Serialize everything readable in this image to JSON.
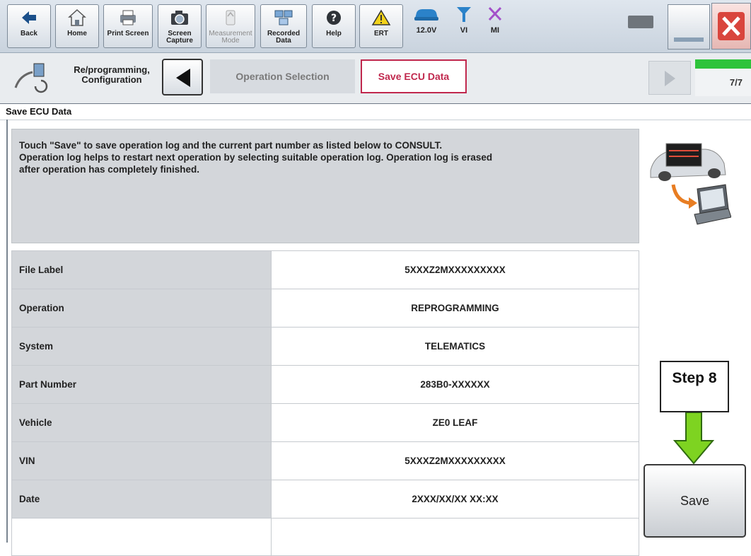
{
  "toolbar": {
    "buttons": [
      {
        "label": "Back",
        "icon": "back-arrow-icon"
      },
      {
        "label": "Home",
        "icon": "home-icon"
      },
      {
        "label": "Print Screen",
        "icon": "printer-icon"
      },
      {
        "label": "Screen Capture",
        "icon": "camera-icon"
      },
      {
        "label": "Measurement Mode",
        "icon": "measurement-icon"
      },
      {
        "label": "Recorded Data",
        "icon": "recorded-data-icon"
      },
      {
        "label": "Help",
        "icon": "help-icon"
      },
      {
        "label": "ERT",
        "icon": "warning-icon"
      }
    ],
    "voltage": "12.0V",
    "vi_label": "VI",
    "mi_label": "MI"
  },
  "breadcrumb": {
    "section": "Re/programming, Configuration",
    "steps": [
      "Operation Selection",
      "Save ECU Data"
    ],
    "progress_label": "7/7",
    "progress_fraction": 1.0
  },
  "page": {
    "title": "Save ECU Data",
    "message_lines": [
      "Touch \"Save\" to save operation log and the current part number as listed below to CONSULT.",
      "Operation log helps to restart next operation by selecting suitable operation log. Operation log is erased",
      "after operation has completely finished."
    ]
  },
  "table": {
    "rows": [
      {
        "label": "File Label",
        "value": "5XXXZ2MXXXXXXXXX"
      },
      {
        "label": "Operation",
        "value": "REPROGRAMMING"
      },
      {
        "label": "System",
        "value": "TELEMATICS"
      },
      {
        "label": "Part Number",
        "value": "283B0-XXXXXX"
      },
      {
        "label": "Vehicle",
        "value": "ZE0 LEAF"
      },
      {
        "label": "VIN",
        "value": "5XXXZ2MXXXXXXXXX"
      },
      {
        "label": "Date",
        "value": "2XXX/XX/XX XX:XX"
      }
    ]
  },
  "annotation": {
    "step_label": "Step 8",
    "arrow_color": "#7ed321"
  },
  "actions": {
    "save_label": "Save"
  },
  "colors": {
    "accent": "#c0284d",
    "progress": "#2ec33b",
    "close": "#d9453d"
  }
}
